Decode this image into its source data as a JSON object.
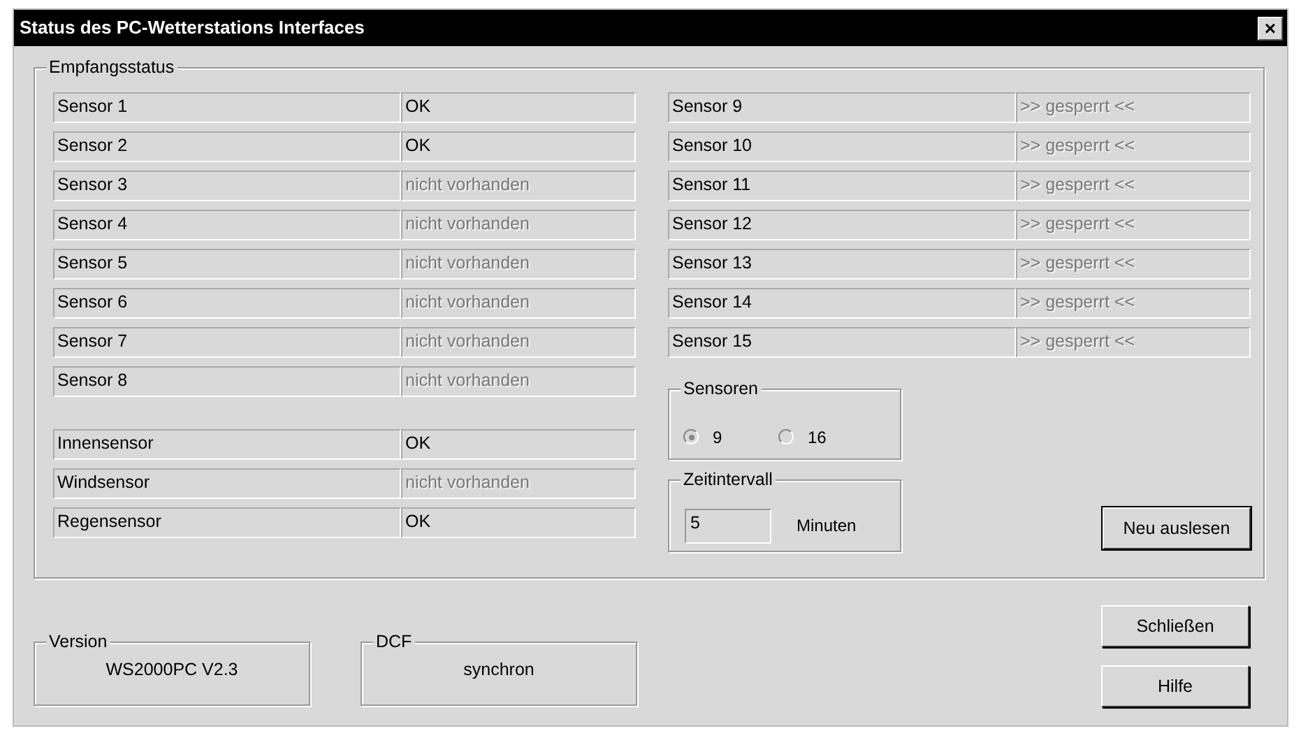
{
  "window": {
    "title": "Status des PC-Wetterstations Interfaces",
    "close": "×"
  },
  "reception": {
    "title": "Empfangsstatus",
    "left_sensors": [
      {
        "label": "Sensor 1",
        "value": "OK",
        "disabled": false
      },
      {
        "label": "Sensor 2",
        "value": "OK",
        "disabled": false
      },
      {
        "label": "Sensor 3",
        "value": "nicht vorhanden",
        "disabled": true
      },
      {
        "label": "Sensor 4",
        "value": "nicht vorhanden",
        "disabled": true
      },
      {
        "label": "Sensor 5",
        "value": "nicht vorhanden",
        "disabled": true
      },
      {
        "label": "Sensor 6",
        "value": "nicht vorhanden",
        "disabled": true
      },
      {
        "label": "Sensor 7",
        "value": "nicht vorhanden",
        "disabled": true
      },
      {
        "label": "Sensor 8",
        "value": "nicht vorhanden",
        "disabled": true
      }
    ],
    "extra_sensors": [
      {
        "label": "Innensensor",
        "value": "OK",
        "disabled": false
      },
      {
        "label": "Windsensor",
        "value": "nicht vorhanden",
        "disabled": true
      },
      {
        "label": "Regensensor",
        "value": "OK",
        "disabled": false
      }
    ],
    "right_sensors": [
      {
        "label": "Sensor 9",
        "value": ">> gesperrt <<",
        "disabled": true
      },
      {
        "label": "Sensor 10",
        "value": ">> gesperrt <<",
        "disabled": true
      },
      {
        "label": "Sensor 11",
        "value": ">> gesperrt <<",
        "disabled": true
      },
      {
        "label": "Sensor 12",
        "value": ">> gesperrt <<",
        "disabled": true
      },
      {
        "label": "Sensor 13",
        "value": ">> gesperrt <<",
        "disabled": true
      },
      {
        "label": "Sensor 14",
        "value": ">> gesperrt <<",
        "disabled": true
      },
      {
        "label": "Sensor 15",
        "value": ">> gesperrt <<",
        "disabled": true
      }
    ],
    "sensor_count": {
      "title": "Sensoren",
      "options": [
        {
          "label": "9",
          "selected": true
        },
        {
          "label": "16",
          "selected": false
        }
      ]
    },
    "interval": {
      "title": "Zeitintervall",
      "value": "5",
      "unit": "Minuten"
    },
    "reread_button": "Neu auslesen"
  },
  "version": {
    "title": "Version",
    "value": "WS2000PC  V2.3"
  },
  "dcf": {
    "title": "DCF",
    "value": "synchron"
  },
  "buttons": [
    "Schließen",
    "Hilfe"
  ]
}
